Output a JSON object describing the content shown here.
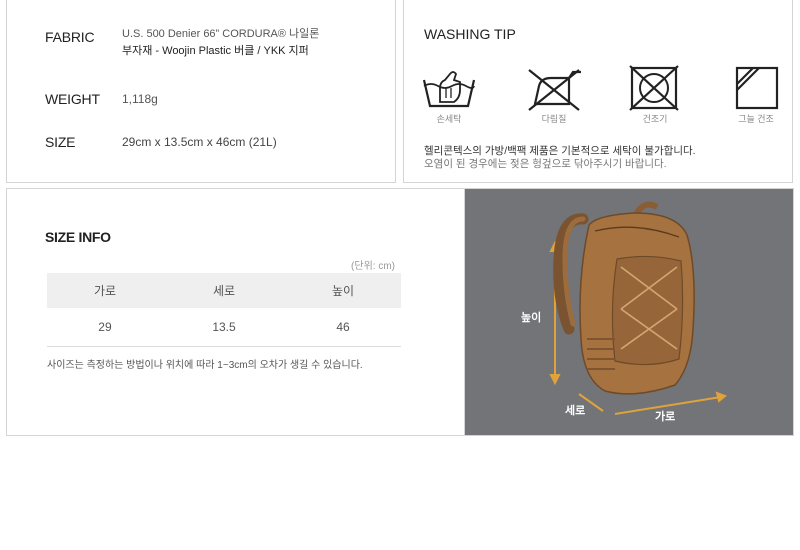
{
  "spec": {
    "fabric_label": "FABRIC",
    "fabric_line1": "U.S. 500 Denier 66” CORDURA® 나일론",
    "fabric_line2": "부자재 - Woojin Plastic 버클 / YKK 지퍼",
    "weight_label": "WEIGHT",
    "weight_value": "1,118g",
    "size_label": "SIZE",
    "size_value": "29cm x 13.5cm x 46cm  (21L)"
  },
  "washing": {
    "title": "WASHING TIP",
    "icons": [
      {
        "icon": "hand-wash-icon",
        "caption": "손세탁"
      },
      {
        "icon": "no-iron-icon",
        "caption": "다림질"
      },
      {
        "icon": "no-tumble-dry-icon",
        "caption": "건조기"
      },
      {
        "icon": "shade-dry-icon",
        "caption": "그늘 건조"
      }
    ],
    "note_line1": "헬리콘텍스의 가방/백팩 제품은 기본적으로 세탁이 불가합니다.",
    "note_line2": "오염이 된 경우에는 젖은 헝겊으로 닦아주시기 바랍니다."
  },
  "size_info": {
    "title": "SIZE INFO",
    "unit": "(단위: cm)",
    "headers": [
      "가로",
      "세로",
      "높이"
    ],
    "values": [
      "29",
      "13.5",
      "46"
    ],
    "note": "사이즈는 측정하는 방법이나 위치에 따라 1~3cm의 오차가 생길 수 있습니다."
  },
  "photo": {
    "height_label": "높이",
    "depth_label": "세로",
    "width_label": "가로",
    "accent_color": "#e0a23a",
    "background_color": "#727478",
    "backpack_color": "#a57240"
  }
}
